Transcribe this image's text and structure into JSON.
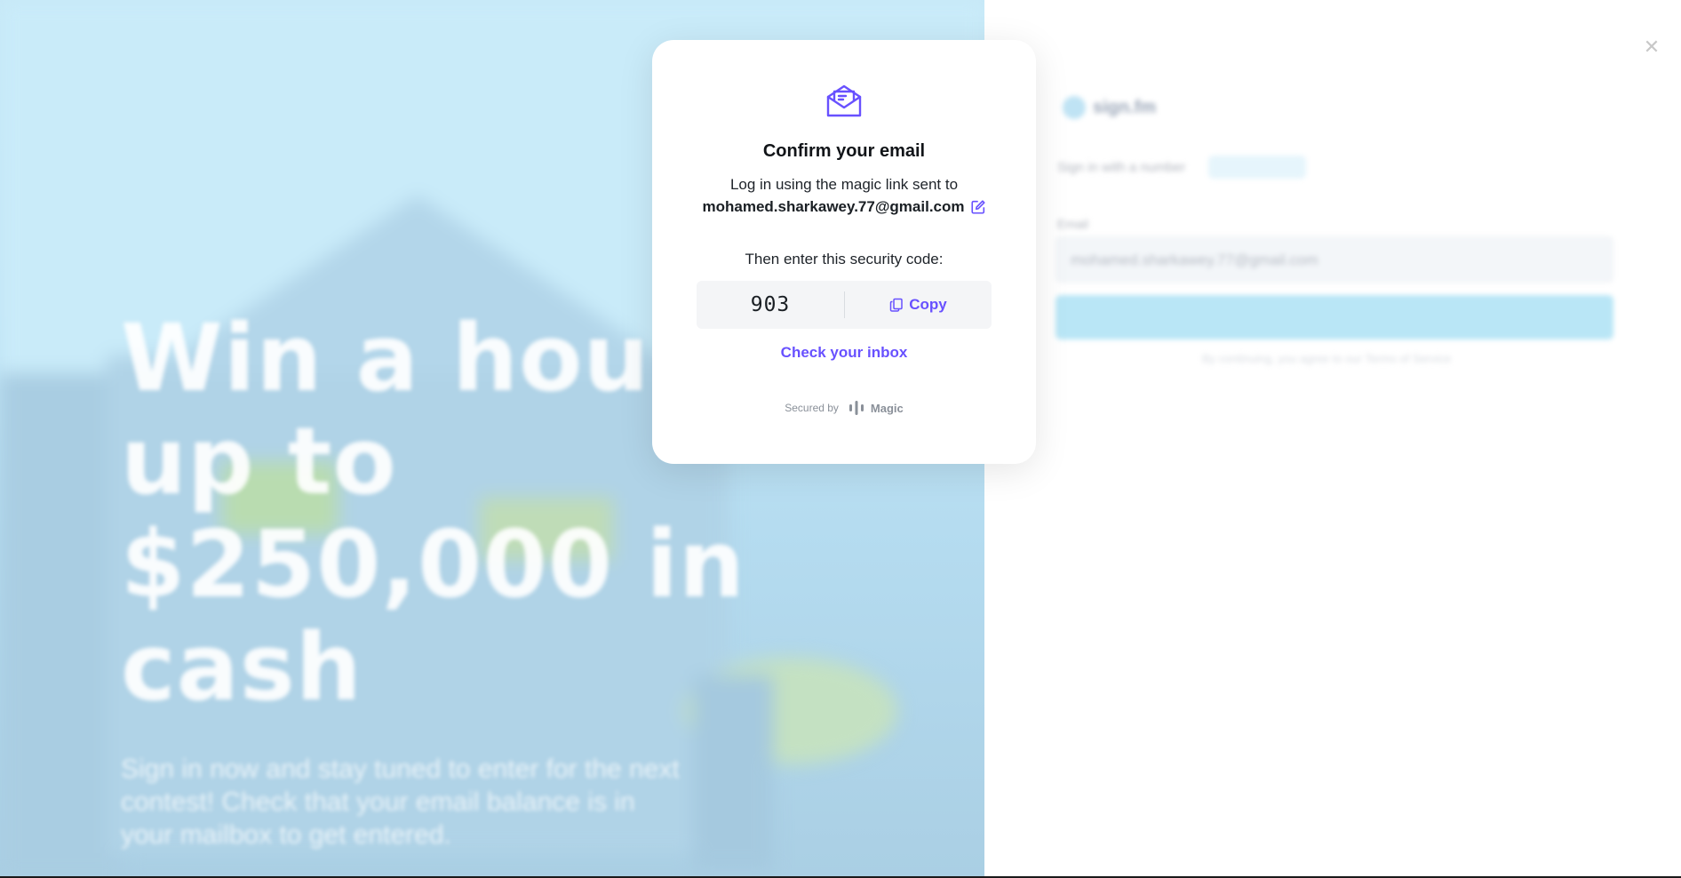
{
  "hero": {
    "title": "Win a house or up to $250,000 in cash",
    "subtitle": "Sign in now and stay tuned to enter for the next contest! Check that your email balance is in your mailbox to get entered."
  },
  "signin_panel": {
    "brand": "sign.fm",
    "tab_label": "Sign in with a number",
    "email_label": "Email",
    "email_value": "mohamed.sharkawey.77@gmail.com",
    "terms": "By continuing, you agree to our Terms of Service"
  },
  "modal": {
    "icon": "mail-open-icon",
    "title": "Confirm your email",
    "description": "Log in using the magic link sent to",
    "email": "mohamed.sharkawey.77@gmail.com",
    "code_prompt": "Then enter this security code:",
    "security_code": "903",
    "copy_label": "Copy",
    "check_inbox_label": "Check your inbox",
    "secured_by_label": "Secured by",
    "provider_name": "Magic"
  },
  "colors": {
    "accent": "#6851ff",
    "hero_bg": "#c2e5f6"
  }
}
